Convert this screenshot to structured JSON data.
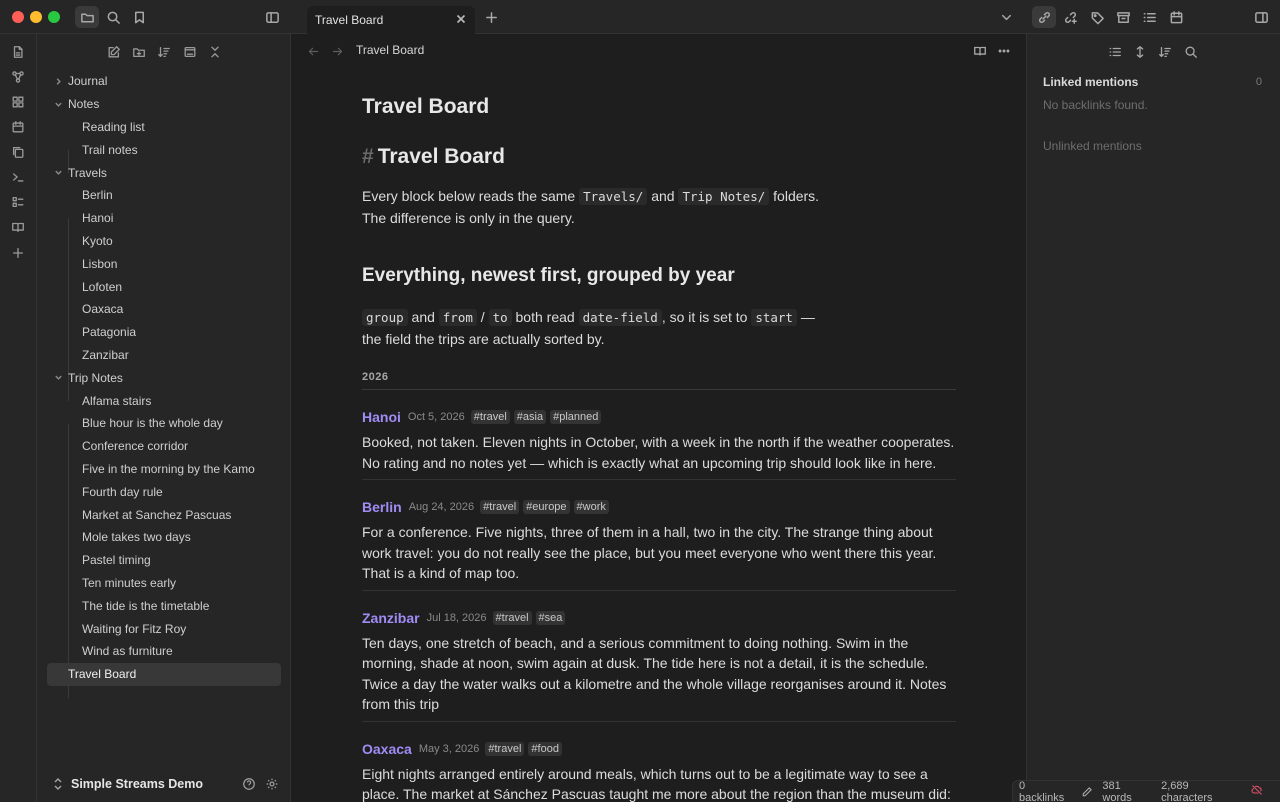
{
  "window": {
    "tab_title": "Travel Board"
  },
  "sidebar": {
    "tree": [
      {
        "label": "Journal",
        "type": "folder",
        "expanded": false
      },
      {
        "label": "Notes",
        "type": "folder",
        "expanded": true,
        "children": [
          "Reading list",
          "Trail notes"
        ]
      },
      {
        "label": "Travels",
        "type": "folder",
        "expanded": true,
        "children": [
          "Berlin",
          "Hanoi",
          "Kyoto",
          "Lisbon",
          "Lofoten",
          "Oaxaca",
          "Patagonia",
          "Zanzibar"
        ]
      },
      {
        "label": "Trip Notes",
        "type": "folder",
        "expanded": true,
        "children": [
          "Alfama stairs",
          "Blue hour is the whole day",
          "Conference corridor",
          "Five in the morning by the Kamo",
          "Fourth day rule",
          "Market at Sanchez Pascuas",
          "Mole takes two days",
          "Pastel timing",
          "Ten minutes early",
          "The tide is the timetable",
          "Waiting for Fitz Roy",
          "Wind as furniture"
        ]
      },
      {
        "label": "Travel Board",
        "type": "file",
        "selected": true
      }
    ],
    "vault_name": "Simple Streams Demo"
  },
  "main": {
    "breadcrumb": "Travel Board",
    "inline_title": "Travel Board",
    "h1": "Travel Board",
    "h1_hash": "#",
    "intro": {
      "t1": "Every block below reads the same ",
      "c1": "Travels/",
      "t2": " and ",
      "c2": "Trip Notes/",
      "t3": " folders. The difference is only in the query."
    },
    "h2": "Everything, newest first, grouped by year",
    "para2": {
      "c1": "group",
      "t1": " and ",
      "c2": "from",
      "t2": " / ",
      "c3": "to",
      "t3": " both read ",
      "c4": "date-field",
      "t4": ", so it is set to ",
      "c5": "start",
      "t5": " — the field the trips are actually sorted by."
    },
    "year": "2026",
    "entries": [
      {
        "title": "Hanoi",
        "date": "Oct 5, 2026",
        "tags": [
          "#travel",
          "#asia",
          "#planned"
        ],
        "body": "Booked, not taken. Eleven nights in October, with a week in the north if the weather cooperates. No rating and no notes yet — which is exactly what an upcoming trip should look like in here."
      },
      {
        "title": "Berlin",
        "date": "Aug 24, 2026",
        "tags": [
          "#travel",
          "#europe",
          "#work"
        ],
        "body": "For a conference. Five nights, three of them in a hall, two in the city. The strange thing about work travel: you do not really see the place, but you meet everyone who went there this year. That is a kind of map too."
      },
      {
        "title": "Zanzibar",
        "date": "Jul 18, 2026",
        "tags": [
          "#travel",
          "#sea"
        ],
        "body": "Ten days, one stretch of beach, and a serious commitment to doing nothing. Swim in the morning, shade at noon, swim again at dusk. The tide here is not a detail, it is the schedule. Twice a day the water walks out a kilometre and the whole village reorganises around it. Notes from this trip"
      },
      {
        "title": "Oaxaca",
        "date": "May 3, 2026",
        "tags": [
          "#travel",
          "#food"
        ],
        "body": "Eight nights arranged entirely around meals, which turns out to be a legitimate way to see a place. The market at Sánchez Pascuas taught me more about the region than the museum did:"
      }
    ]
  },
  "backlinks": {
    "linked_heading": "Linked mentions",
    "linked_count": "0",
    "no_backlinks": "No backlinks found.",
    "unlinked_heading": "Unlinked mentions"
  },
  "status": {
    "backlinks": "0 backlinks",
    "words": "381 words",
    "characters": "2,689 characters"
  },
  "colors": {
    "accent_link": "#a18cf5",
    "background": "#1e1e1e",
    "sidebar": "#262626"
  }
}
